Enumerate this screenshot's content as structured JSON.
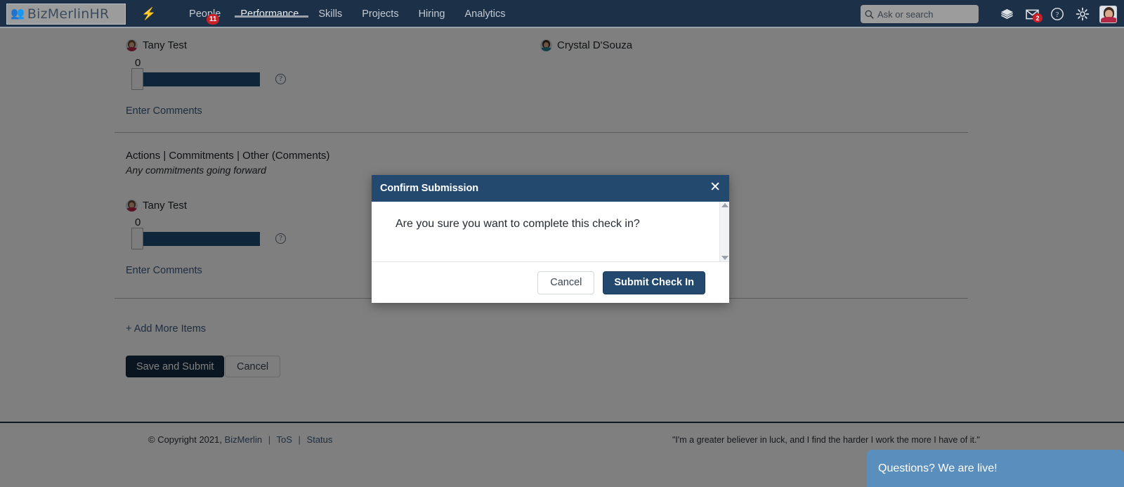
{
  "topnav": {
    "brand": "BizMerlinHR",
    "brand_icon": "people-group-icon",
    "bolt_icon": "lightning-bolt-icon",
    "links": [
      {
        "label": "People",
        "badge": "11",
        "active": false
      },
      {
        "label": "Performance",
        "badge": "",
        "active": true
      },
      {
        "label": "Skills",
        "badge": "",
        "active": false
      },
      {
        "label": "Projects",
        "badge": "",
        "active": false
      },
      {
        "label": "Hiring",
        "badge": "",
        "active": false
      },
      {
        "label": "Analytics",
        "badge": "",
        "active": false
      }
    ],
    "search_placeholder": "Ask or search",
    "search_value": "",
    "mail_badge": "2",
    "icons": [
      "layers-icon",
      "mail-icon",
      "help-circle-icon",
      "gear-icon",
      "user-avatar"
    ]
  },
  "main": {
    "item1": {
      "reviewer": "Tany Test",
      "score": "0",
      "comment_link": "Enter Comments",
      "help_icon": "question-circle-icon"
    },
    "item1_right": {
      "reviewer": "Crystal D'Souza"
    },
    "section2": {
      "title": "Actions | Commitments | Other (Comments)",
      "subtitle": "Any commitments going forward",
      "reviewer": "Tany Test",
      "score": "0",
      "comment_link": "Enter Comments",
      "help_icon": "question-circle-icon"
    },
    "add_more": "+ Add More Items",
    "save_submit": "Save and Submit",
    "cancel": "Cancel"
  },
  "modal": {
    "title": "Confirm Submission",
    "close_icon": "close-icon",
    "body": "Are you sure you want to complete this check in?",
    "cancel": "Cancel",
    "submit": "Submit Check In"
  },
  "footer": {
    "copyright": "© Copyright 2021,",
    "brand_link": "BizMerlin",
    "tos_link": "ToS",
    "status_link": "Status",
    "separator": "|",
    "quote": "\"I'm a greater believer in luck, and I find the harder I work the more I have of it.\"",
    "chat": "Questions? We are live!"
  },
  "colors": {
    "navbar": "#1c3047",
    "modal_header": "#23496f",
    "slider_bar": "#1f4b75",
    "primary_button": "#122c44",
    "badge_red": "#c9202a",
    "chat_blue": "#5a8fbd",
    "link_blue": "#3c5a80"
  }
}
